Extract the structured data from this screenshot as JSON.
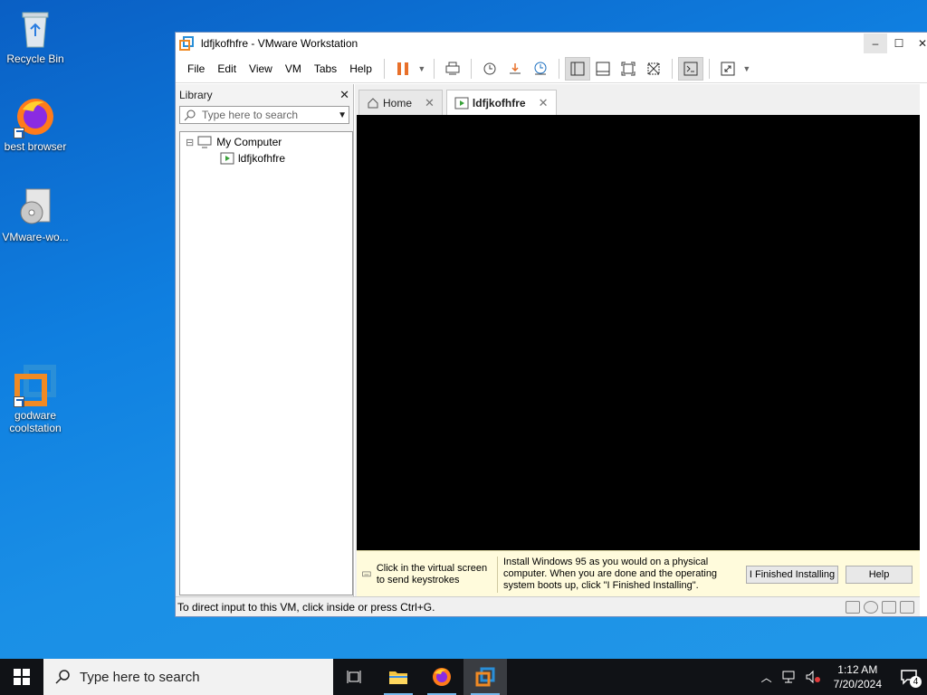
{
  "desktop": {
    "icons": [
      {
        "label": "Recycle Bin"
      },
      {
        "label": "best browser"
      },
      {
        "label": "VMware-wo..."
      },
      {
        "label": "godware coolstation"
      }
    ]
  },
  "window": {
    "title": "ldfjkofhfre - VMware Workstation",
    "menu": [
      "File",
      "Edit",
      "View",
      "VM",
      "Tabs",
      "Help"
    ],
    "controls": {
      "minimize": "–",
      "maximize": "☐",
      "close": "✕"
    }
  },
  "library": {
    "title": "Library",
    "close": "✕",
    "search_placeholder": "Type here to search",
    "tree": {
      "root": "My Computer",
      "child": "ldfjkofhfre",
      "expander": "⊟"
    }
  },
  "tabs": [
    {
      "label": "Home",
      "close": "✕"
    },
    {
      "label": "ldfjkofhfre",
      "close": "✕"
    }
  ],
  "hint": {
    "left": "Click in the virtual screen to send keystrokes",
    "message": "Install Windows 95 as you would on a physical computer. When you are done and the operating system boots up, click \"I Finished Installing\".",
    "finished_button": "I Finished Installing",
    "help_button": "Help"
  },
  "status": {
    "text": "To direct input to this VM, click inside or press Ctrl+G."
  },
  "taskbar": {
    "search_placeholder": "Type here to search",
    "time": "1:12 AM",
    "date": "7/20/2024",
    "notification_count": "4"
  },
  "colors": {
    "accent": "#0a64c8",
    "pause": "#e8702a",
    "taskbar": "#101216"
  }
}
